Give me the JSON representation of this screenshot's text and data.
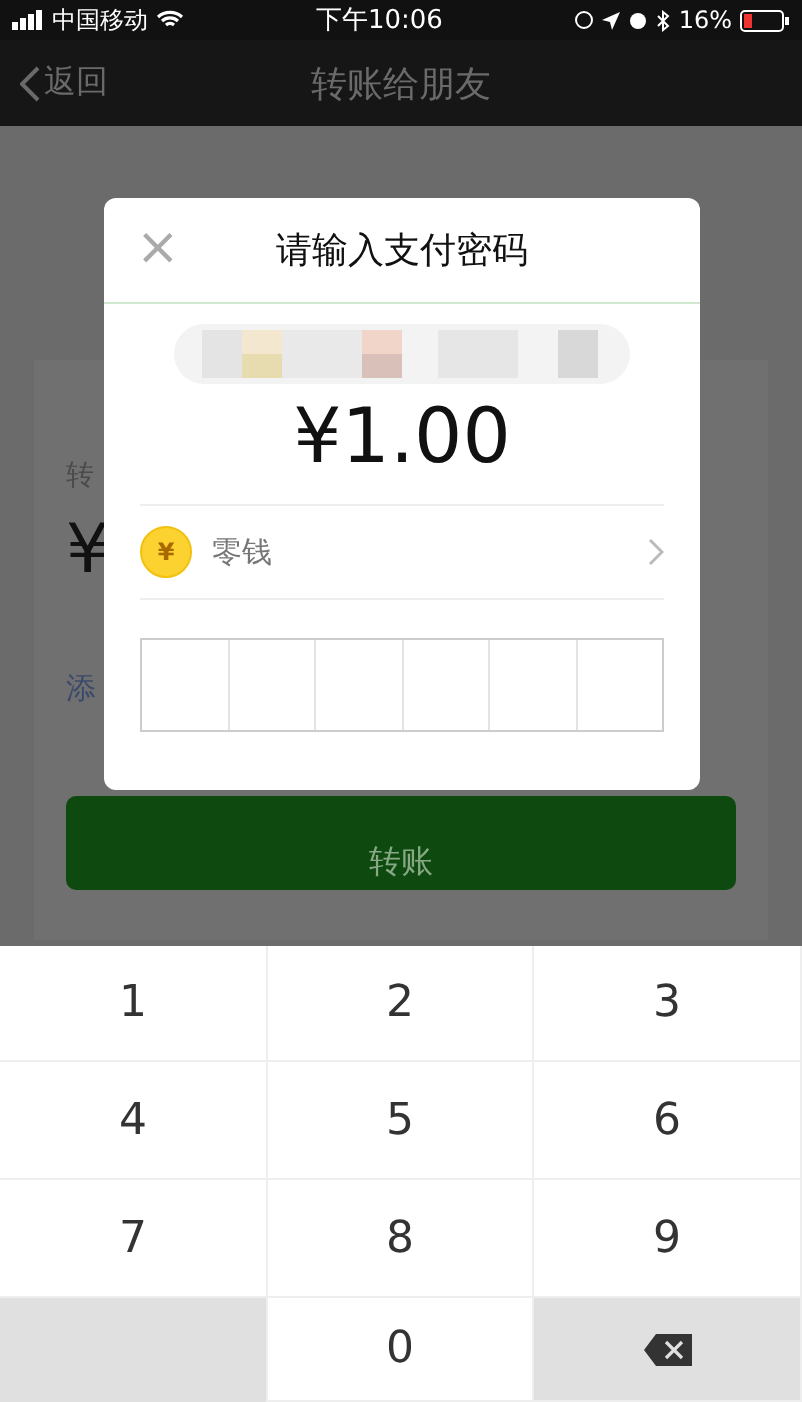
{
  "status_bar": {
    "carrier": "中国移动",
    "time": "下午10:06",
    "battery_percent": "16%"
  },
  "nav": {
    "back": "返回",
    "title": "转账给朋友"
  },
  "background_form": {
    "label": "转",
    "amount_symbol": "¥",
    "note_link": "添",
    "button": "转账"
  },
  "dialog": {
    "close": "×",
    "title": "请输入支付密码",
    "amount": "¥1.00",
    "payment_method": "零钱",
    "coin_symbol": "¥"
  },
  "keypad": {
    "keys": [
      {
        "kind": "digit",
        "label": "1"
      },
      {
        "kind": "digit",
        "label": "2"
      },
      {
        "kind": "digit",
        "label": "3"
      },
      {
        "kind": "digit",
        "label": "4"
      },
      {
        "kind": "digit",
        "label": "5"
      },
      {
        "kind": "digit",
        "label": "6"
      },
      {
        "kind": "digit",
        "label": "7"
      },
      {
        "kind": "digit",
        "label": "8"
      },
      {
        "kind": "digit",
        "label": "9"
      },
      {
        "kind": "blank"
      },
      {
        "kind": "digit",
        "label": "0"
      },
      {
        "kind": "backspace"
      }
    ]
  }
}
